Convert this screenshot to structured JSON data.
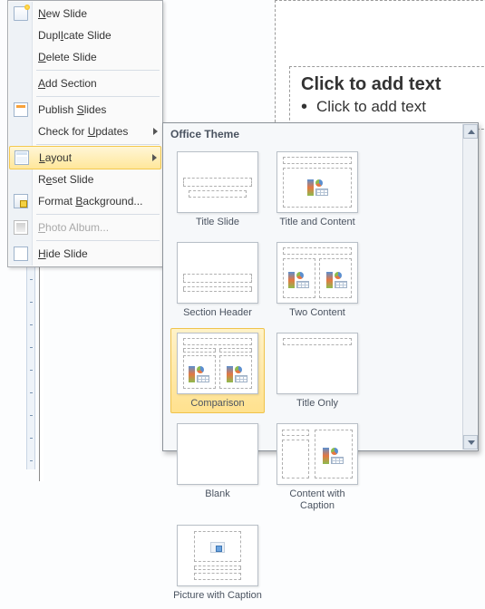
{
  "slide": {
    "title_placeholder": "Click to add text",
    "body_placeholder": "Click to add text"
  },
  "context_menu": {
    "new_slide": "New Slide",
    "duplicate_slide": "Duplicate Slide",
    "delete_slide": "Delete Slide",
    "add_section": "Add Section",
    "publish_slides": "Publish Slides",
    "check_updates": "Check for Updates",
    "layout": "Layout",
    "reset_slide": "Reset Slide",
    "format_background": "Format Background...",
    "photo_album": "Photo Album...",
    "hide_slide": "Hide Slide",
    "underline": {
      "new_slide": "N",
      "duplicate_slide": "I",
      "delete_slide": "D",
      "add_section": "A",
      "publish_slides": "S",
      "check_updates": "U",
      "layout": "L",
      "reset_slide": "e",
      "format_background": "B",
      "photo_album": "P",
      "hide_slide": "H"
    }
  },
  "flyout": {
    "header": "Office Theme",
    "layouts": {
      "title_slide": "Title Slide",
      "title_content": "Title and Content",
      "section_header": "Section Header",
      "two_content": "Two Content",
      "comparison": "Comparison",
      "title_only": "Title Only",
      "blank": "Blank",
      "content_caption": "Content with Caption",
      "picture_caption": "Picture with Caption"
    },
    "selected": "comparison"
  },
  "colors": {
    "highlight": "#ffe79b",
    "border": "#a7abb0"
  }
}
